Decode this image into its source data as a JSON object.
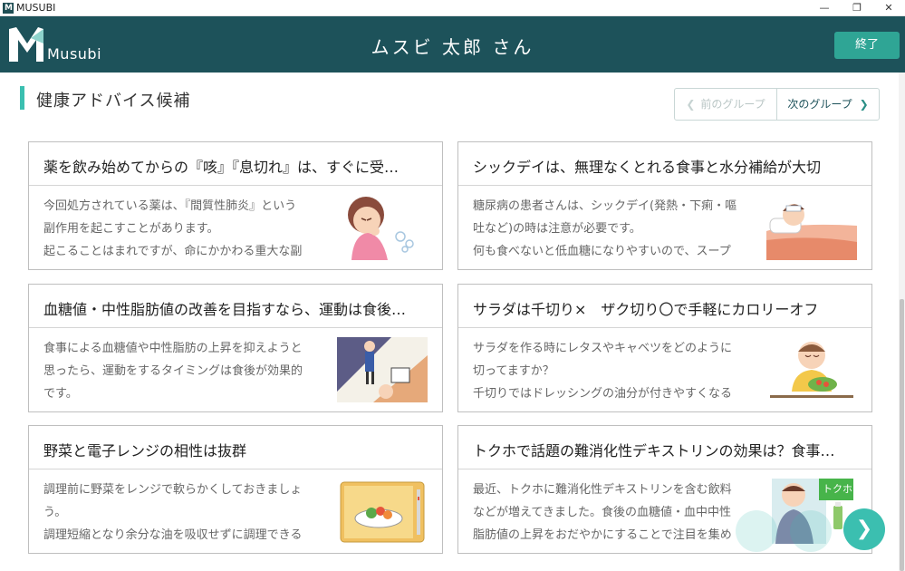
{
  "window": {
    "title": "MUSUBI",
    "icon_letter": "M"
  },
  "window_controls": {
    "minimize": "—",
    "maximize": "❐",
    "close": "✕"
  },
  "header": {
    "logo_text": "Musubi",
    "user_name": "ムスビ 太郎 さん",
    "exit_label": "終了"
  },
  "section": {
    "title": "健康アドバイス候補"
  },
  "group_nav": {
    "prev_label": "前のグループ",
    "next_label": "次のグループ",
    "prev_arrow": "❮",
    "next_arrow": "❯"
  },
  "cards": [
    {
      "title": "薬を飲み始めてからの『咳』『息切れ』は、すぐに受…",
      "lines": [
        "今回処方されている薬は、『間質性肺炎』という",
        "副作用を起こすことがあります。",
        "起こることはまれですが、命にかかわる重大な副"
      ],
      "illustration": "coughing-woman"
    },
    {
      "title": "シックデイは、無理なくとれる食事と水分補給が大切",
      "lines": [
        "糖尿病の患者さんは、シックデイ(発熱・下痢・嘔",
        "吐など)の時は注意が必要です。",
        "何も食べないと低血糖になりやすいので、スープ"
      ],
      "illustration": "sick-in-bed"
    },
    {
      "title": "血糖値・中性脂肪値の改善を目指すなら、運動は食後…",
      "lines": [
        "食事による血糖値や中性脂肪の上昇を抑えようと",
        "思ったら、運動をするタイミングは食後が効果的",
        "です。"
      ],
      "illustration": "exercise-after-meal"
    },
    {
      "title": "サラダは千切り×　ザク切り〇で手軽にカロリーオフ",
      "lines": [
        "サラダを作る時にレタスやキャベツをどのように",
        "切ってますか？",
        "千切りではドレッシングの油分が付きやすくなる"
      ],
      "illustration": "eating-salad"
    },
    {
      "title": "野菜と電子レンジの相性は抜群",
      "lines": [
        "調理前に野菜をレンジで軟らかくしておきましょ",
        "う。",
        "調理短縮となり余分な油を吸収せずに調理できる"
      ],
      "illustration": "microwave-vegetables"
    },
    {
      "title": "トクホで話題の難消化性デキストリンの効果は？食事…",
      "lines": [
        "最近、トクホに難消化性デキストリンを含む飲料",
        "などが増えてきました。食後の血糖値・血中中性",
        "脂肪値の上昇をおだやかにすることで注目を集め"
      ],
      "illustration": "tokuho-drink",
      "illustration_label": "トクホ"
    }
  ],
  "floating_controls": {
    "next_arrow": "❯"
  },
  "colors": {
    "header_bg": "#1d525a",
    "accent": "#3bbfb0",
    "exit_button": "#2fa595",
    "fab": "#3bbfb0"
  }
}
